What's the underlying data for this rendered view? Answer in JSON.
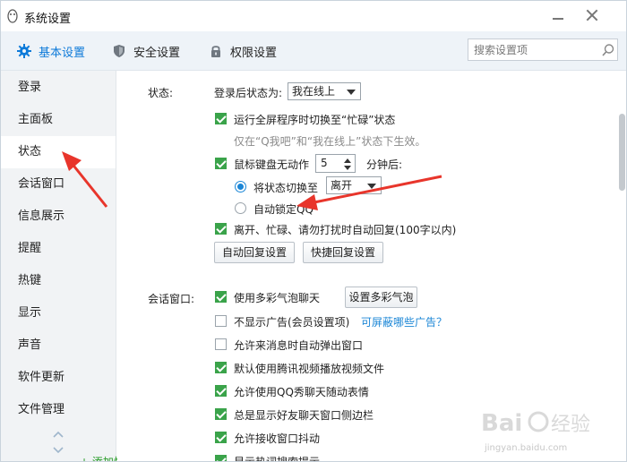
{
  "window": {
    "title": "系统设置"
  },
  "tabs": [
    {
      "label": "基本设置",
      "icon": "gear-icon",
      "active": true
    },
    {
      "label": "安全设置",
      "icon": "shield-icon",
      "active": false
    },
    {
      "label": "权限设置",
      "icon": "lock-icon",
      "active": false
    }
  ],
  "search": {
    "placeholder": "搜索设置项"
  },
  "sidebar": {
    "items": [
      {
        "label": "登录"
      },
      {
        "label": "主面板"
      },
      {
        "label": "状态",
        "active": true
      },
      {
        "label": "会话窗口"
      },
      {
        "label": "信息展示"
      },
      {
        "label": "提醒"
      },
      {
        "label": "热键"
      },
      {
        "label": "显示"
      },
      {
        "label": "声音"
      },
      {
        "label": "软件更新"
      },
      {
        "label": "文件管理"
      }
    ],
    "add_card": "+ 添加快捷卡片"
  },
  "status_section": {
    "title": "状态:",
    "login_status_label": "登录后状态为:",
    "login_status_value": "我在线上",
    "fullscreen_busy": {
      "label": "运行全屏程序时切换至“忙碌”状态",
      "checked": true
    },
    "fullscreen_note": "仅在“Q我吧”和“我在线上”状态下生效。",
    "idle": {
      "label": "鼠标键盘无动作",
      "minutes": "5",
      "suffix": "分钟后:",
      "checked": true
    },
    "idle_switch": {
      "label": "将状态切换至",
      "value": "离开",
      "selected": true
    },
    "idle_lock": {
      "label": "自动锁定QQ",
      "selected": false
    },
    "auto_reply": {
      "label": "离开、忙碌、请勿打扰时自动回复(100字以内)",
      "checked": true
    },
    "auto_reply_button": "自动回复设置",
    "quick_reply_button": "快捷回复设置"
  },
  "chat_section": {
    "title": "会话窗口:",
    "options": [
      {
        "label": "使用多彩气泡聊天",
        "checked": true
      },
      {
        "label": "不显示广告(会员设置项)",
        "checked": false
      },
      {
        "label": "允许来消息时自动弹出窗口",
        "checked": false
      },
      {
        "label": "默认使用腾讯视频播放视频文件",
        "checked": true
      },
      {
        "label": "允许使用QQ秀聊天随动表情",
        "checked": true
      },
      {
        "label": "总是显示好友聊天窗口侧边栏",
        "checked": true
      },
      {
        "label": "允许接收窗口抖动",
        "checked": true
      },
      {
        "label": "显示热词搜索提示",
        "checked": true
      }
    ],
    "bubble_button": "设置多彩气泡",
    "ad_link": "可屏蔽哪些广告？"
  },
  "watermark": {
    "text": "jingyan.baidu.com"
  },
  "colors": {
    "accent": "#0d7ad9",
    "check": "#3aa34a",
    "arrow": "#e8352b"
  }
}
